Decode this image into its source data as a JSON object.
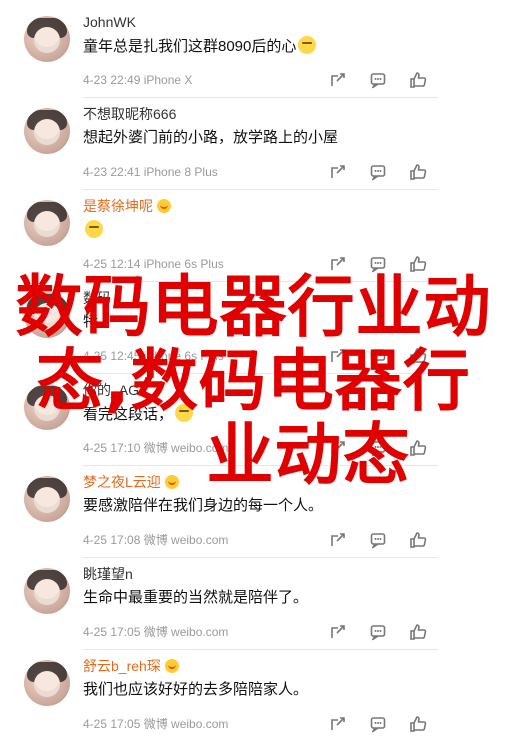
{
  "comments": [
    {
      "user": "JohnWK",
      "user_color": "#333333",
      "has_badge": false,
      "text": "童年总是扎我们这群8090后的心",
      "has_emoji": true,
      "meta": "4-23 22:49 iPhone X"
    },
    {
      "user": "不想取昵称666",
      "user_color": "#333333",
      "has_badge": false,
      "text": "想起外婆门前的小路，放学路上的小屋",
      "has_emoji": false,
      "meta": "4-23 22:41 iPhone 8 Plus"
    },
    {
      "user": "是蔡徐坤呢",
      "user_color": "#e26b1f",
      "has_badge": true,
      "text": "",
      "has_emoji": true,
      "meta": "4-25 12:14 iPhone 6s Plus"
    },
    {
      "user": "数码",
      "user_color": "#333333",
      "has_badge": false,
      "text": "特",
      "has_emoji": false,
      "meta": "4-25 12:45 iPhone 6s Plus"
    },
    {
      "user": "你的_AG",
      "user_color": "#333333",
      "has_badge": false,
      "text": "看完这段话，",
      "has_emoji": true,
      "meta": "4-25 17:10 微博 weibo.com"
    },
    {
      "user": "梦之夜L云迎",
      "user_color": "#e26b1f",
      "has_badge": true,
      "text": "要感激陪伴在我们身边的每一个人。",
      "has_emoji": false,
      "meta": "4-25 17:08 微博 weibo.com"
    },
    {
      "user": "眺瑾望n",
      "user_color": "#333333",
      "has_badge": false,
      "text": "生命中最重要的当然就是陪伴了。",
      "has_emoji": false,
      "meta": "4-25 17:05 微博 weibo.com"
    },
    {
      "user": "舒云b_reh琛",
      "user_color": "#e26b1f",
      "has_badge": true,
      "text": "我们也应该好好的去多陪陪家人。",
      "has_emoji": false,
      "meta": "4-25 17:05 微博 weibo.com"
    }
  ],
  "headline": {
    "line1": "数码电器行业动",
    "line2": "态,数码电器行",
    "line3": "业动态"
  },
  "icons": {
    "share": "share-icon",
    "comment": "comment-icon",
    "like": "like-icon"
  }
}
